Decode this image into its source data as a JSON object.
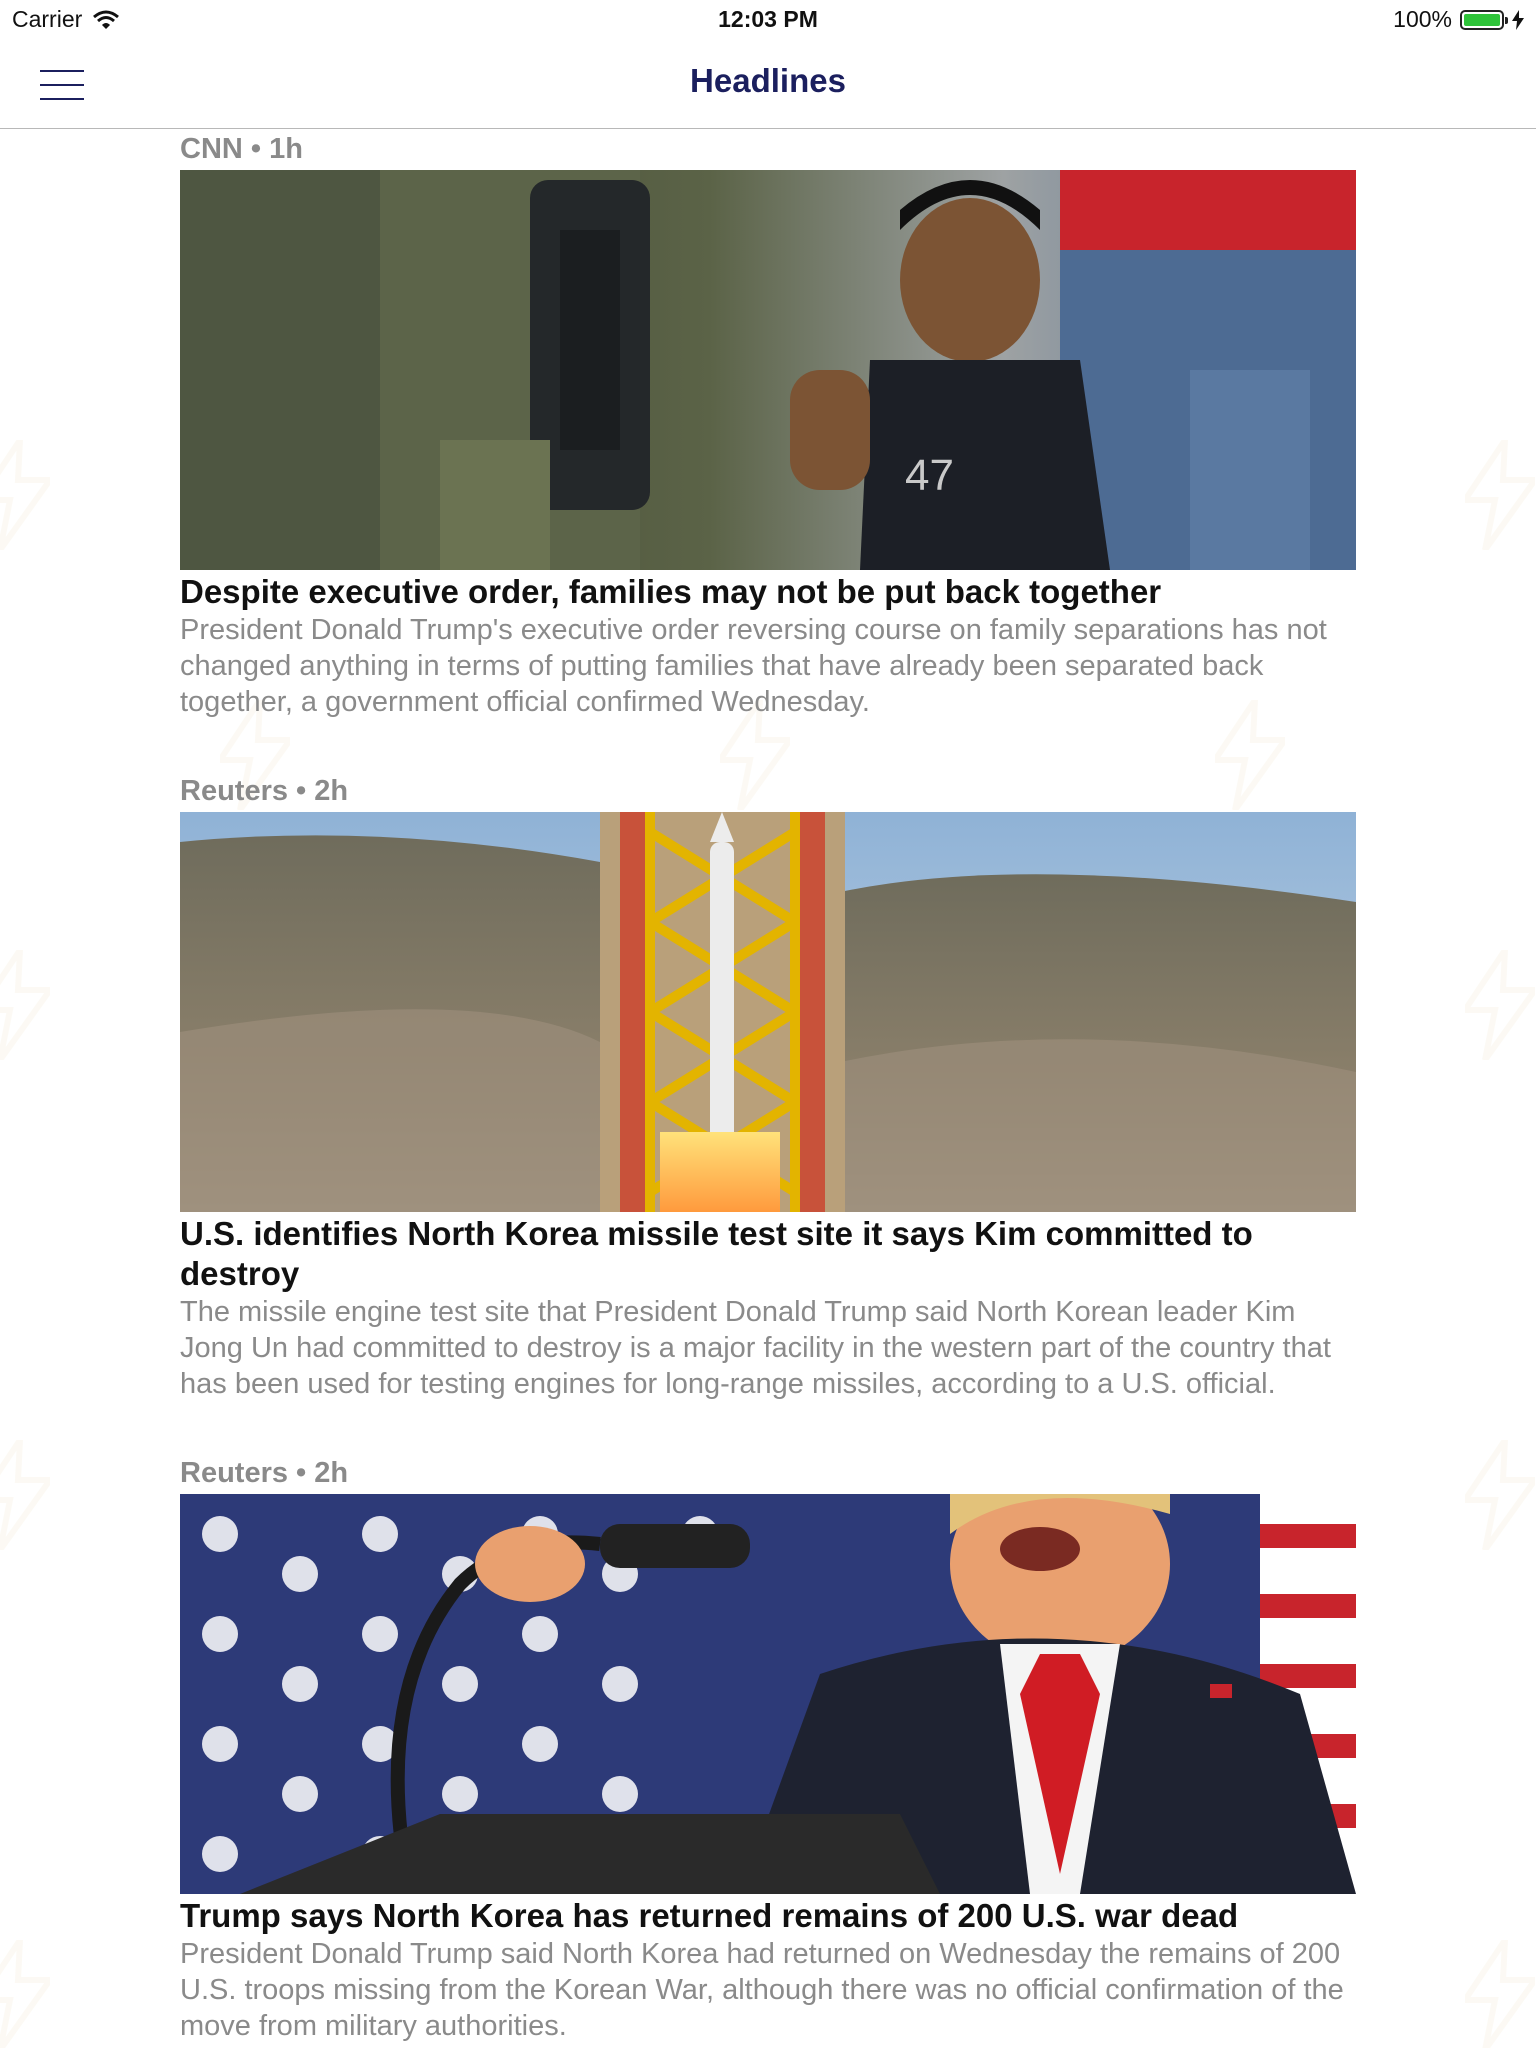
{
  "status_bar": {
    "carrier": "Carrier",
    "time": "12:03 PM",
    "battery": "100%"
  },
  "nav": {
    "title": "Headlines"
  },
  "articles": [
    {
      "source": "CNN",
      "age": "1h",
      "meta": "CNN • 1h",
      "headline": "Despite executive order, families may not be put back together",
      "summary": "President Donald Trump's executive order reversing course on family separations has not changed anything in terms of putting families that have already been separated back together, a government official confirmed Wednesday."
    },
    {
      "source": "Reuters",
      "age": "2h",
      "meta": "Reuters • 2h",
      "headline": "U.S. identifies North Korea missile test site it says Kim committed to destroy",
      "summary": "The missile engine test site that President Donald Trump said North Korean leader Kim Jong Un had committed to destroy is a major facility in the western part of the country that has been used for testing engines for long-range missiles, according to a U.S. official."
    },
    {
      "source": "Reuters",
      "age": "2h",
      "meta": "Reuters • 2h",
      "headline": "Trump says North Korea has returned remains of 200 U.S. war dead",
      "summary": "President Donald Trump said North Korea had returned on Wednesday the remains of 200 U.S. troops missing from the Korean War, although there was no official confirmation of the move from military authorities."
    }
  ]
}
